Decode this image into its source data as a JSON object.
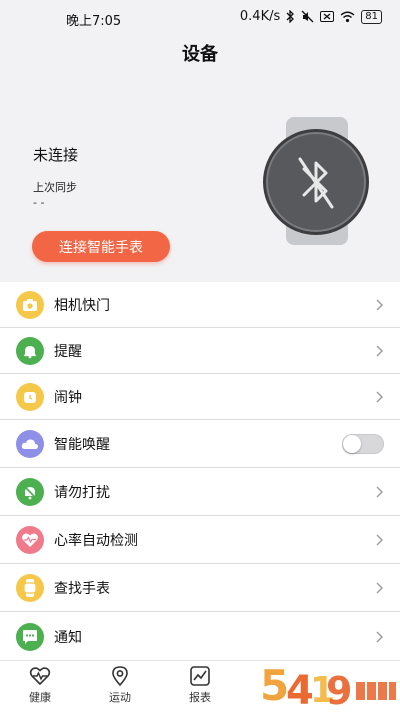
{
  "status_bar": {
    "time": "晚上7:05",
    "network_speed": "0.4K/s",
    "battery": "81"
  },
  "header": {
    "title": "设备"
  },
  "device": {
    "connection_status": "未连接",
    "last_sync_label": "上次同步",
    "last_sync_value": "- -",
    "connect_button": "连接智能手表",
    "watch_icon": "bluetooth-off-icon"
  },
  "menu": [
    {
      "label": "相机快门",
      "icon": "camera-icon",
      "color": "#f5c84a"
    },
    {
      "label": "提醒",
      "icon": "bell-icon",
      "color": "#4caf50"
    },
    {
      "label": "闹钟",
      "icon": "alarm-clock-icon",
      "color": "#f5c84a"
    },
    {
      "label": "智能唤醒",
      "icon": "sleep-cloud-icon",
      "color": "#8e8fe6",
      "toggle": false
    },
    {
      "label": "请勿打扰",
      "icon": "bell-off-icon",
      "color": "#4caf50"
    },
    {
      "label": "心率自动检测",
      "icon": "heart-rate-icon",
      "color": "#f07a8a"
    },
    {
      "label": "查找手表",
      "icon": "watch-icon",
      "color": "#f5c84a"
    },
    {
      "label": "通知",
      "icon": "chat-bubble-icon",
      "color": "#4caf50"
    }
  ],
  "tabs": [
    {
      "label": "健康",
      "icon": "heartbeat-icon"
    },
    {
      "label": "运动",
      "icon": "location-pin-icon"
    },
    {
      "label": "报表",
      "icon": "chart-icon"
    }
  ],
  "colors": {
    "accent": "#f26545",
    "background": "#f2f2f4"
  }
}
